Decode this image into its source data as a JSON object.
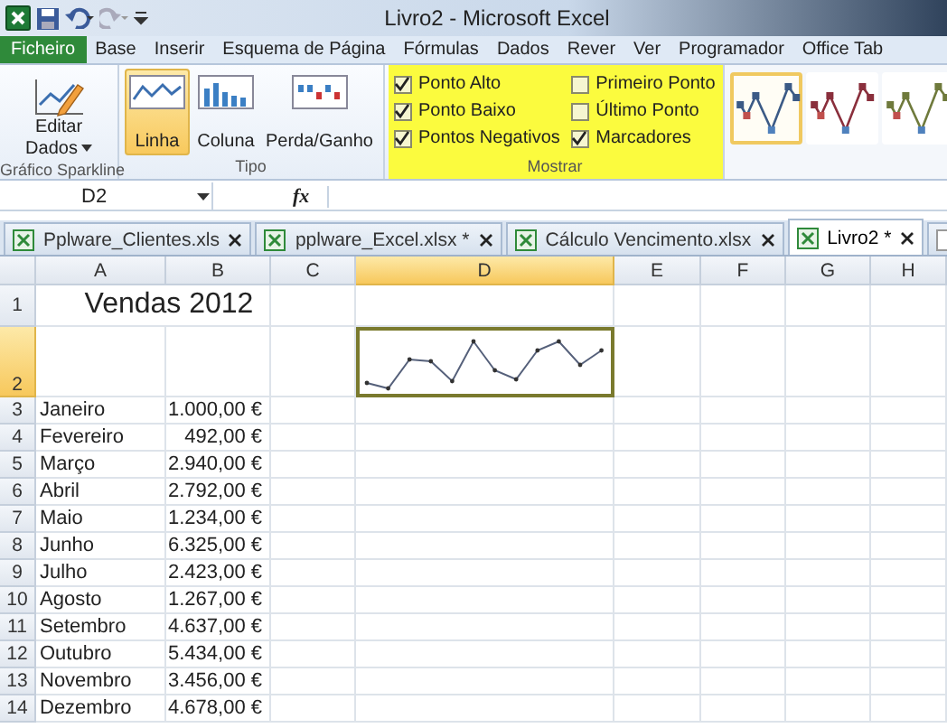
{
  "window": {
    "title": "Livro2  -  Microsoft Excel"
  },
  "menu_tabs": [
    {
      "label": "Ficheiro",
      "kind": "file",
      "selected": false
    },
    {
      "label": "Base",
      "kind": "tab",
      "selected": false
    },
    {
      "label": "Inserir",
      "kind": "tab",
      "selected": false
    },
    {
      "label": "Esquema de Página",
      "kind": "tab",
      "selected": false
    },
    {
      "label": "Fórmulas",
      "kind": "tab",
      "selected": false
    },
    {
      "label": "Dados",
      "kind": "tab",
      "selected": false
    },
    {
      "label": "Rever",
      "kind": "tab",
      "selected": false
    },
    {
      "label": "Ver",
      "kind": "tab",
      "selected": false
    },
    {
      "label": "Programador",
      "kind": "tab",
      "selected": false
    },
    {
      "label": "Office Tab",
      "kind": "tab",
      "selected": false
    }
  ],
  "ribbon": {
    "edit_group": {
      "button": "Editar Dados",
      "label": "Gráfico Sparkline"
    },
    "type_group": {
      "label": "Tipo",
      "buttons": [
        {
          "label": "Linha",
          "kind": "line",
          "selected": true
        },
        {
          "label": "Coluna",
          "kind": "column",
          "selected": false
        },
        {
          "label": "Perda/Ganho",
          "kind": "winloss",
          "selected": false
        }
      ]
    },
    "show_group": {
      "label": "Mostrar",
      "highlighted": true,
      "options": [
        {
          "label": "Ponto Alto",
          "checked": true
        },
        {
          "label": "Ponto Baixo",
          "checked": true
        },
        {
          "label": "Pontos Negativos",
          "checked": true
        },
        {
          "label": "Primeiro Ponto",
          "checked": false
        },
        {
          "label": "Último Ponto",
          "checked": false
        },
        {
          "label": "Marcadores",
          "checked": true
        }
      ]
    },
    "styles": [
      {
        "color": "#3b5a86",
        "selected": true
      },
      {
        "color": "#8a2f3c",
        "selected": false
      },
      {
        "color": "#6f7a3c",
        "selected": false
      }
    ]
  },
  "formula_bar": {
    "name_box": "D2",
    "fx": "fx"
  },
  "workbook_tabs": [
    {
      "label": "Pplware_Clientes.xls",
      "selected": false
    },
    {
      "label": "pplware_Excel.xlsx *",
      "selected": false
    },
    {
      "label": "Cálculo Vencimento.xlsx",
      "selected": false
    },
    {
      "label": "Livro2 *",
      "selected": true
    }
  ],
  "sheet": {
    "columns": [
      {
        "label": "A",
        "selected": false
      },
      {
        "label": "B",
        "selected": false
      },
      {
        "label": "C",
        "selected": false
      },
      {
        "label": "D",
        "selected": true
      },
      {
        "label": "E",
        "selected": false
      },
      {
        "label": "F",
        "selected": false
      },
      {
        "label": "G",
        "selected": false
      },
      {
        "label": "H",
        "selected": false
      }
    ],
    "rows": [
      {
        "number": "1",
        "kind": "title",
        "text": "Vendas 2012",
        "selected": false
      },
      {
        "number": "2",
        "kind": "sparkline",
        "selected": true
      },
      {
        "number": "3",
        "kind": "data",
        "month": "Janeiro",
        "value": "1.000,00 €",
        "selected": false
      },
      {
        "number": "4",
        "kind": "data",
        "month": "Fevereiro",
        "value": "492,00 €",
        "selected": false
      },
      {
        "number": "5",
        "kind": "data",
        "month": "Março",
        "value": "2.940,00 €",
        "selected": false
      },
      {
        "number": "6",
        "kind": "data",
        "month": "Abril",
        "value": "2.792,00 €",
        "selected": false
      },
      {
        "number": "7",
        "kind": "data",
        "month": "Maio",
        "value": "1.234,00 €",
        "selected": false
      },
      {
        "number": "8",
        "kind": "data",
        "month": "Junho",
        "value": "6.325,00 €",
        "selected": false
      },
      {
        "number": "9",
        "kind": "data",
        "month": "Julho",
        "value": "2.423,00 €",
        "selected": false
      },
      {
        "number": "10",
        "kind": "data",
        "month": "Agosto",
        "value": "1.267,00 €",
        "selected": false
      },
      {
        "number": "11",
        "kind": "data",
        "month": "Setembro",
        "value": "4.637,00 €",
        "selected": false
      },
      {
        "number": "12",
        "kind": "data",
        "month": "Outubro",
        "value": "5.434,00 €",
        "selected": false
      },
      {
        "number": "13",
        "kind": "data",
        "month": "Novembro",
        "value": "3.456,00 €",
        "selected": false
      },
      {
        "number": "14",
        "kind": "data",
        "month": "Dezembro",
        "value": "4.678,00 €",
        "selected": false
      }
    ]
  }
}
